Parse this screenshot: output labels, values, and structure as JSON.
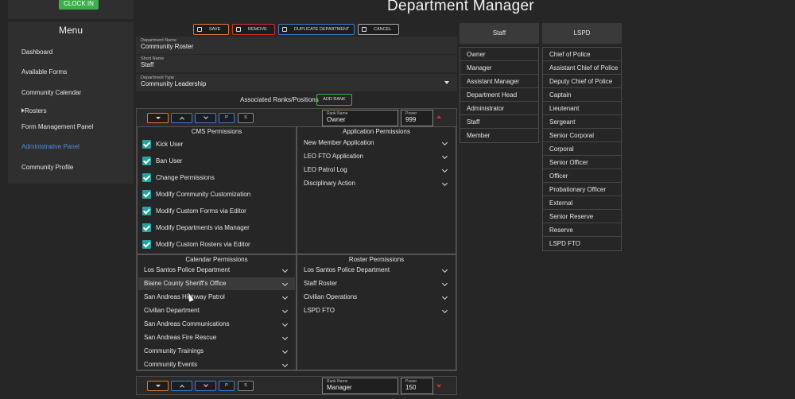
{
  "clock_in": "CLOCK IN",
  "menu": {
    "title": "Menu",
    "items": [
      {
        "label": "Dashboard"
      },
      {
        "label": "Available Forms"
      },
      {
        "label": "Community Calendar"
      },
      {
        "label": "Rosters"
      },
      {
        "label": "Form Management Panel"
      },
      {
        "label": "Administrative Panel"
      },
      {
        "label": "Community Profile"
      }
    ]
  },
  "page_title": "Department Manager",
  "toolbar": {
    "save": "SAVE",
    "remove": "REMOVE",
    "duplicate": "DUPLICATE DEPARTMENT",
    "cancel": "CANCEL"
  },
  "department": {
    "name_label": "Department Name",
    "name_value": "Community Roster",
    "short_label": "Short Name",
    "short_value": "Staff",
    "type_label": "Department Type",
    "type_value": "Community Leadership"
  },
  "associated_label": "Associated Ranks/Positions",
  "add_rank": "ADD RANK",
  "rank_controls": {
    "p": "P",
    "s": "S"
  },
  "rank1": {
    "name_label": "Rank Name",
    "name_value": "Owner",
    "power_label": "Power",
    "power_value": "999"
  },
  "rank2": {
    "name_label": "Rank Name",
    "name_value": "Manager",
    "power_label": "Power",
    "power_value": "150"
  },
  "cms": {
    "title": "CMS Permissions",
    "items": [
      "Kick User",
      "Ban User",
      "Change Permissions",
      "Modify Community Customization",
      "Modify Custom Forms via Editor",
      "Modify Departments via Manager",
      "Modify Custom Rosters via Editor"
    ]
  },
  "application": {
    "title": "Application Permissions",
    "items": [
      "New Member Application",
      "LEO FTO Application",
      "LEO Patrol Log",
      "Disciplinary Action"
    ]
  },
  "calendar": {
    "title": "Calendar Permissions",
    "items": [
      "Los Santos Police Department",
      "Blaine County Sheriff's Office",
      "San Andreas Highway Patrol",
      "Civilian Department",
      "San Andreas Communications",
      "San Andreas Fire Rescue",
      "Community Trainings",
      "Community Events"
    ]
  },
  "roster": {
    "title": "Roster Permissions",
    "items": [
      "Los Santos Police Department",
      "Staff Roster",
      "Civilian Operations",
      "LSPD FTO"
    ]
  },
  "staff_col": {
    "header": "Staff",
    "items": [
      "Owner",
      "Manager",
      "Assistant Manager",
      "Department Head",
      "Administrator",
      "Staff",
      "Member"
    ]
  },
  "lspd_col": {
    "header": "LSPD",
    "items": [
      "Chief of Police",
      "Assistant Chief of Police",
      "Deputy Chief of Police",
      "Captain",
      "Lieutenant",
      "Sergeant",
      "Senior Corporal",
      "Corporal",
      "Senior Officer",
      "Officer",
      "Probationary Officer",
      "External",
      "Senior Reserve",
      "Reserve",
      "LSPD FTO"
    ]
  },
  "colors": {
    "accent_green": "#3fae49",
    "teal_check": "#25a3a0",
    "orange": "#e07a30",
    "red": "#d03030",
    "blue": "#3b7fd1",
    "link_blue": "#4a8fdd"
  }
}
